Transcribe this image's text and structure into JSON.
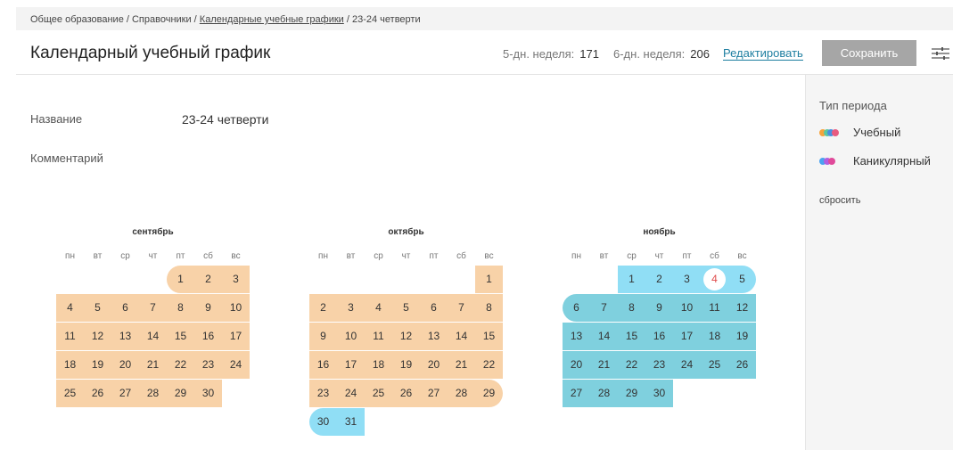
{
  "breadcrumb": {
    "part1": "Общее образование / Справочники / ",
    "link": "Календарные учебные графики",
    "part2": " / 23-24 четверти"
  },
  "header": {
    "title": "Календарный учебный график",
    "stat5_label": "5-дн. неделя:",
    "stat5_value": "171",
    "stat6_label": "6-дн. неделя:",
    "stat6_value": "206",
    "edit_label": "Редактировать",
    "save_label": "Сохранить",
    "filter_icon": "sliders-icon"
  },
  "form": {
    "name_label": "Название",
    "name_value": "23-24 четверти",
    "comment_label": "Комментарий",
    "comment_value": ""
  },
  "sidebar": {
    "title": "Тип периода",
    "legend": [
      {
        "label": "Учебный",
        "colors": [
          "#f6a43c",
          "#5cc8a0",
          "#4a8fe0",
          "#e85a80"
        ]
      },
      {
        "label": "Каникулярный",
        "colors": [
          "#4aa3f0",
          "#b060e0",
          "#e04a9a"
        ]
      }
    ],
    "reset_label": "сбросить"
  },
  "colors": {
    "study": "#f8d2a8",
    "vacation_light": "#90def5",
    "vacation": "#7fd0de",
    "today": "#e04b4b",
    "accent_link": "#1d7ea0"
  },
  "weekdays": [
    "пн",
    "вт",
    "ср",
    "чт",
    "пт",
    "сб",
    "вс"
  ],
  "calendar": [
    {
      "name": "сентябрь",
      "weeks": [
        [
          null,
          null,
          null,
          null,
          {
            "d": "1",
            "t": "study",
            "r": "l"
          },
          {
            "d": "2",
            "t": "study"
          },
          {
            "d": "3",
            "t": "study"
          }
        ],
        [
          {
            "d": "4",
            "t": "study"
          },
          {
            "d": "5",
            "t": "study"
          },
          {
            "d": "6",
            "t": "study"
          },
          {
            "d": "7",
            "t": "study"
          },
          {
            "d": "8",
            "t": "study"
          },
          {
            "d": "9",
            "t": "study"
          },
          {
            "d": "10",
            "t": "study"
          }
        ],
        [
          {
            "d": "11",
            "t": "study"
          },
          {
            "d": "12",
            "t": "study"
          },
          {
            "d": "13",
            "t": "study"
          },
          {
            "d": "14",
            "t": "study"
          },
          {
            "d": "15",
            "t": "study"
          },
          {
            "d": "16",
            "t": "study"
          },
          {
            "d": "17",
            "t": "study"
          }
        ],
        [
          {
            "d": "18",
            "t": "study"
          },
          {
            "d": "19",
            "t": "study"
          },
          {
            "d": "20",
            "t": "study"
          },
          {
            "d": "21",
            "t": "study"
          },
          {
            "d": "22",
            "t": "study"
          },
          {
            "d": "23",
            "t": "study"
          },
          {
            "d": "24",
            "t": "study"
          }
        ],
        [
          {
            "d": "25",
            "t": "study"
          },
          {
            "d": "26",
            "t": "study"
          },
          {
            "d": "27",
            "t": "study"
          },
          {
            "d": "28",
            "t": "study"
          },
          {
            "d": "29",
            "t": "study"
          },
          {
            "d": "30",
            "t": "study"
          },
          null
        ]
      ]
    },
    {
      "name": "октябрь",
      "weeks": [
        [
          null,
          null,
          null,
          null,
          null,
          null,
          {
            "d": "1",
            "t": "study"
          }
        ],
        [
          {
            "d": "2",
            "t": "study"
          },
          {
            "d": "3",
            "t": "study"
          },
          {
            "d": "4",
            "t": "study"
          },
          {
            "d": "5",
            "t": "study"
          },
          {
            "d": "6",
            "t": "study"
          },
          {
            "d": "7",
            "t": "study"
          },
          {
            "d": "8",
            "t": "study"
          }
        ],
        [
          {
            "d": "9",
            "t": "study"
          },
          {
            "d": "10",
            "t": "study"
          },
          {
            "d": "11",
            "t": "study"
          },
          {
            "d": "12",
            "t": "study"
          },
          {
            "d": "13",
            "t": "study"
          },
          {
            "d": "14",
            "t": "study"
          },
          {
            "d": "15",
            "t": "study"
          }
        ],
        [
          {
            "d": "16",
            "t": "study"
          },
          {
            "d": "17",
            "t": "study"
          },
          {
            "d": "18",
            "t": "study"
          },
          {
            "d": "19",
            "t": "study"
          },
          {
            "d": "20",
            "t": "study"
          },
          {
            "d": "21",
            "t": "study"
          },
          {
            "d": "22",
            "t": "study"
          }
        ],
        [
          {
            "d": "23",
            "t": "study"
          },
          {
            "d": "24",
            "t": "study"
          },
          {
            "d": "25",
            "t": "study"
          },
          {
            "d": "26",
            "t": "study"
          },
          {
            "d": "27",
            "t": "study"
          },
          {
            "d": "28",
            "t": "study"
          },
          {
            "d": "29",
            "t": "study",
            "r": "r"
          }
        ],
        [
          {
            "d": "30",
            "t": "vac1",
            "r": "l"
          },
          {
            "d": "31",
            "t": "vac1"
          },
          null,
          null,
          null,
          null,
          null
        ]
      ]
    },
    {
      "name": "ноябрь",
      "weeks": [
        [
          null,
          null,
          {
            "d": "1",
            "t": "vac1"
          },
          {
            "d": "2",
            "t": "vac1"
          },
          {
            "d": "3",
            "t": "vac1"
          },
          {
            "d": "4",
            "t": "vac1",
            "today": true
          },
          {
            "d": "5",
            "t": "vac1",
            "r": "r"
          }
        ],
        [
          {
            "d": "6",
            "t": "vac2",
            "r": "l"
          },
          {
            "d": "7",
            "t": "vac2"
          },
          {
            "d": "8",
            "t": "vac2"
          },
          {
            "d": "9",
            "t": "vac2"
          },
          {
            "d": "10",
            "t": "vac2"
          },
          {
            "d": "11",
            "t": "vac2"
          },
          {
            "d": "12",
            "t": "vac2"
          }
        ],
        [
          {
            "d": "13",
            "t": "vac2"
          },
          {
            "d": "14",
            "t": "vac2"
          },
          {
            "d": "15",
            "t": "vac2"
          },
          {
            "d": "16",
            "t": "vac2"
          },
          {
            "d": "17",
            "t": "vac2"
          },
          {
            "d": "18",
            "t": "vac2"
          },
          {
            "d": "19",
            "t": "vac2"
          }
        ],
        [
          {
            "d": "20",
            "t": "vac2"
          },
          {
            "d": "21",
            "t": "vac2"
          },
          {
            "d": "22",
            "t": "vac2"
          },
          {
            "d": "23",
            "t": "vac2"
          },
          {
            "d": "24",
            "t": "vac2"
          },
          {
            "d": "25",
            "t": "vac2"
          },
          {
            "d": "26",
            "t": "vac2"
          }
        ],
        [
          {
            "d": "27",
            "t": "vac2"
          },
          {
            "d": "28",
            "t": "vac2"
          },
          {
            "d": "29",
            "t": "vac2"
          },
          {
            "d": "30",
            "t": "vac2"
          },
          null,
          null,
          null
        ]
      ]
    }
  ]
}
